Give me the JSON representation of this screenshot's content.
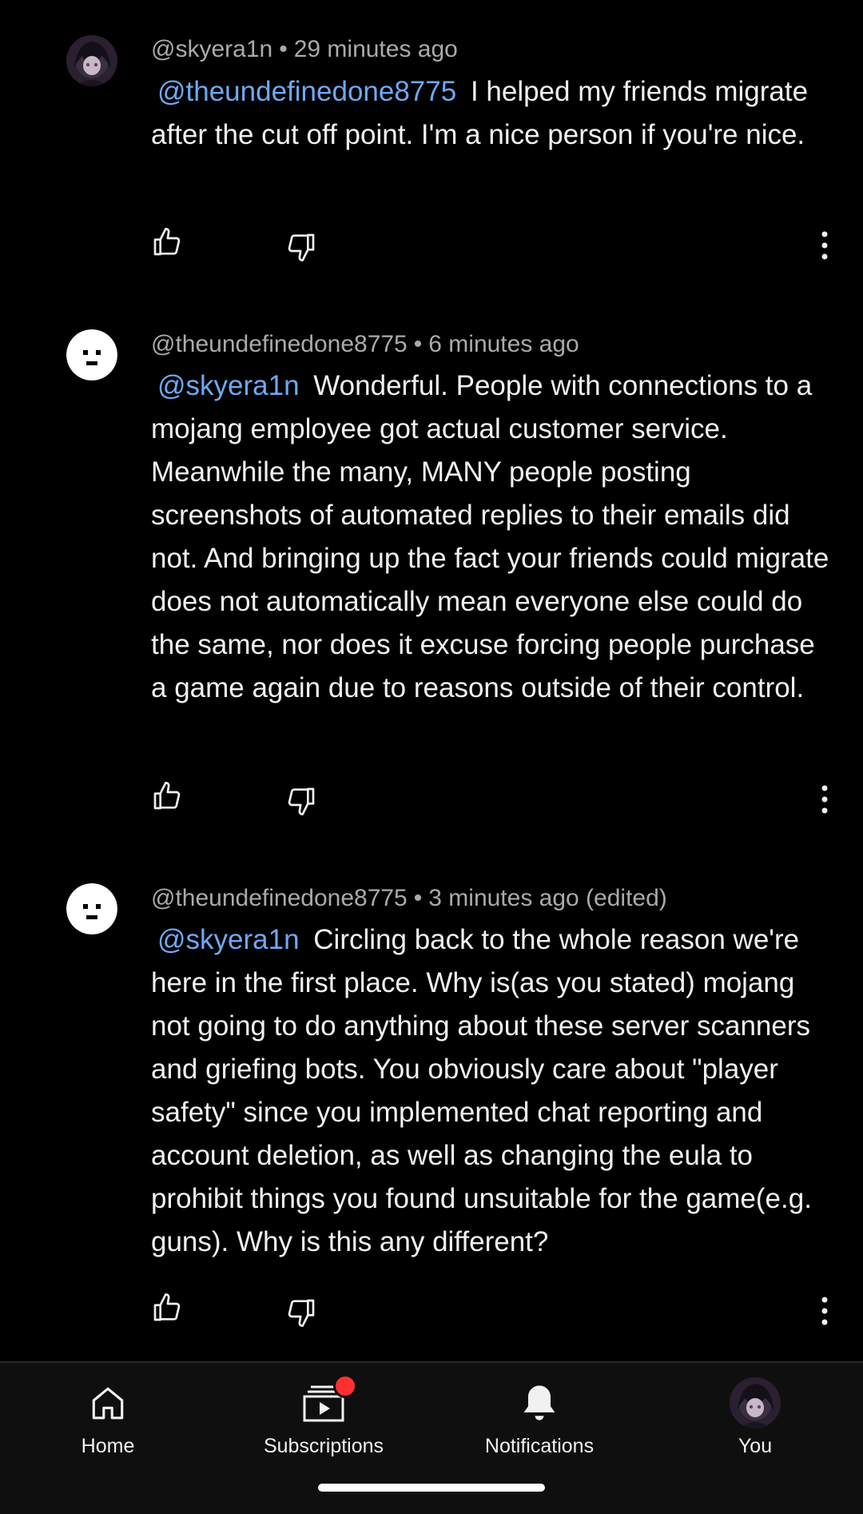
{
  "comments": [
    {
      "author": "@skyera1n",
      "time": "29 minutes ago",
      "avatar": "anime-avatar",
      "mention": "@theundefinedone8775",
      "text": "I helped my friends migrate after the cut off point. I'm a nice person if you're nice."
    },
    {
      "author": "@theundefinedone8775",
      "time": "6 minutes ago",
      "avatar": "default-face-avatar",
      "mention": "@skyera1n",
      "text": "Wonderful. People with connections to a mojang employee got actual customer service. Meanwhile the many, MANY people posting screenshots of automated replies to their emails did not. And bringing up the fact your friends could migrate does not automatically mean everyone else could do the same, nor does it excuse forcing people purchase a game again due to reasons outside of their control."
    },
    {
      "author": "@theundefinedone8775",
      "time": "3 minutes ago (edited)",
      "avatar": "default-face-avatar",
      "mention": "@skyera1n",
      "text": "Circling back to the whole reason we're here in the first place. Why is(as you stated) mojang not going to do anything about these server scanners and griefing bots. You obviously care about \"player safety\" since you implemented chat reporting and account deletion, as well as changing the eula to prohibit things you found unsuitable for the game(e.g. guns). Why is this any different?"
    }
  ],
  "separator": "•",
  "nav": {
    "home": "Home",
    "subscriptions": "Subscriptions",
    "notifications": "Notifications",
    "you": "You"
  },
  "colors": {
    "background": "#000000",
    "text": "#f1f1f1",
    "meta": "#aaaaaa",
    "mention": "#6fa8f5",
    "badge": "#ff3030",
    "navbar": "#0f0f0f"
  },
  "icons": {
    "like": "thumbs-up-icon",
    "dislike": "thumbs-down-icon",
    "more": "more-vertical-icon",
    "home": "home-icon",
    "subscriptions": "subscriptions-icon",
    "notifications": "bell-icon"
  }
}
